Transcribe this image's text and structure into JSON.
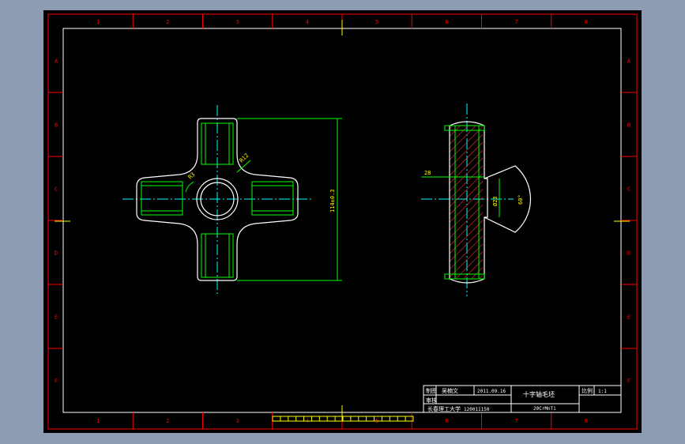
{
  "colors": {
    "background": "#000000",
    "window": "#8d9cb2",
    "frame": "#ff0000",
    "border_inner": "#ffffff",
    "geometry": "#ffffff",
    "thread": "#00ff00",
    "centerline": "#00ffff",
    "dimension": "#00ff00",
    "dim_text": "#ffff00",
    "hatch": "#ff3030",
    "title_block": "#ffffff"
  },
  "zones": {
    "columns": [
      "1",
      "2",
      "3",
      "4",
      "5",
      "6",
      "7",
      "8"
    ],
    "rows": [
      "A",
      "B",
      "C",
      "D",
      "E",
      "F"
    ]
  },
  "dimensions": {
    "radius_r12": "R12",
    "radius_r3": "R3",
    "height": "114±0.3",
    "offset_28": "28",
    "dia_23": "Ø23",
    "angle_60": "60°"
  },
  "title_block": {
    "drawn_label": "制图",
    "drawn_name": "吴楠文",
    "drawn_date": "2011.09.16",
    "check_label": "审核",
    "drawing_title": "十字轴毛坯",
    "scale_label": "比例",
    "scale_value": "1:1",
    "school": "长春理工大学",
    "code": "120011150",
    "material_note": "20CrMnTi"
  }
}
